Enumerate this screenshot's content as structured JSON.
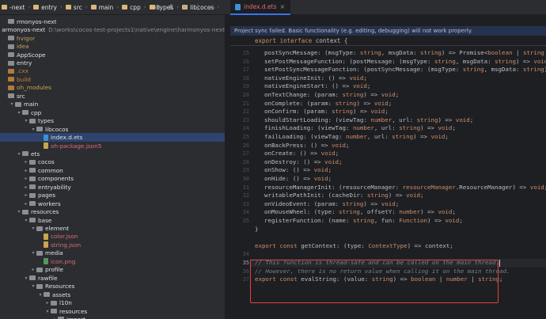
{
  "breadcrumb": [
    {
      "label": "-next",
      "kind": "folder"
    },
    {
      "label": "entry",
      "kind": "folder"
    },
    {
      "label": "src",
      "kind": "folder"
    },
    {
      "label": "main",
      "kind": "folder"
    },
    {
      "label": "cpp",
      "kind": "folder"
    },
    {
      "label": "types",
      "kind": "folder"
    },
    {
      "label": "libcocos",
      "kind": "folder"
    },
    {
      "label": "index.d.ets",
      "kind": "file"
    }
  ],
  "toolbar_icons": [
    "target-icon",
    "collapse-icon",
    "close-icon",
    "settings-icon",
    "minimize-icon"
  ],
  "editor_tab": {
    "label": "index.d.ets",
    "close": "×"
  },
  "notice": "Project sync failed. Basic functionality (e.g. editing, debugging) will not work properly.",
  "tree": [
    {
      "label": "rmonyos-next",
      "indent": 0,
      "icon": "folder",
      "style": "norm"
    },
    {
      "label": "armonyos-next",
      "path": "D:\\works\\cocos-test-projects1\\native\\engine\\harmonyos-next",
      "indent": 0,
      "icon": "none",
      "style": "norm"
    },
    {
      "label": "hvigor",
      "indent": 0,
      "icon": "folder",
      "style": "dim"
    },
    {
      "label": "idea",
      "indent": 0,
      "icon": "folder",
      "style": "dim"
    },
    {
      "label": "AppScope",
      "indent": 0,
      "icon": "folder",
      "style": "norm"
    },
    {
      "label": "entry",
      "indent": 0,
      "icon": "folder",
      "style": "norm"
    },
    {
      "label": ".cxx",
      "indent": 0,
      "icon": "folder-o",
      "style": "brown"
    },
    {
      "label": "build",
      "indent": 0,
      "icon": "folder-o",
      "style": "brown"
    },
    {
      "label": "oh_modules",
      "indent": 0,
      "icon": "folder-o",
      "style": "yel"
    },
    {
      "label": "src",
      "indent": 0,
      "icon": "folder",
      "style": "norm"
    },
    {
      "label": "main",
      "indent": 1,
      "arrow": "down",
      "icon": "folder",
      "style": "norm"
    },
    {
      "label": "cpp",
      "indent": 2,
      "arrow": "down",
      "icon": "folder",
      "style": "norm"
    },
    {
      "label": "types",
      "indent": 3,
      "arrow": "down",
      "icon": "folder",
      "style": "norm"
    },
    {
      "label": "libcocos",
      "indent": 4,
      "arrow": "down",
      "icon": "folder",
      "style": "norm"
    },
    {
      "label": "index.d.ets",
      "indent": 5,
      "icon": "file",
      "style": "norm",
      "selected": true
    },
    {
      "label": "oh-package.json5",
      "indent": 5,
      "icon": "file-j",
      "style": "red"
    },
    {
      "label": "ets",
      "indent": 2,
      "arrow": "down",
      "icon": "folder",
      "style": "norm"
    },
    {
      "label": "cocos",
      "indent": 3,
      "arrow": "right",
      "icon": "folder",
      "style": "norm"
    },
    {
      "label": "common",
      "indent": 3,
      "arrow": "right",
      "icon": "folder",
      "style": "norm"
    },
    {
      "label": "components",
      "indent": 3,
      "arrow": "right",
      "icon": "folder",
      "style": "norm"
    },
    {
      "label": "entryability",
      "indent": 3,
      "arrow": "right",
      "icon": "folder",
      "style": "norm"
    },
    {
      "label": "pages",
      "indent": 3,
      "arrow": "right",
      "icon": "folder",
      "style": "norm"
    },
    {
      "label": "workers",
      "indent": 3,
      "arrow": "right",
      "icon": "folder",
      "style": "norm"
    },
    {
      "label": "resources",
      "indent": 2,
      "arrow": "down",
      "icon": "folder",
      "style": "norm"
    },
    {
      "label": "base",
      "indent": 3,
      "arrow": "down",
      "icon": "folder",
      "style": "norm"
    },
    {
      "label": "element",
      "indent": 4,
      "arrow": "down",
      "icon": "folder",
      "style": "norm"
    },
    {
      "label": "color.json",
      "indent": 5,
      "icon": "file-j",
      "style": "red"
    },
    {
      "label": "string.json",
      "indent": 5,
      "icon": "file-j",
      "style": "red"
    },
    {
      "label": "media",
      "indent": 4,
      "arrow": "down",
      "icon": "folder",
      "style": "norm"
    },
    {
      "label": "icon.png",
      "indent": 5,
      "icon": "file-p",
      "style": "red"
    },
    {
      "label": "profile",
      "indent": 4,
      "arrow": "right",
      "icon": "folder",
      "style": "norm"
    },
    {
      "label": "rawfile",
      "indent": 3,
      "arrow": "down",
      "icon": "folder",
      "style": "norm"
    },
    {
      "label": "Resources",
      "indent": 4,
      "arrow": "down",
      "icon": "folder",
      "style": "norm"
    },
    {
      "label": "assets",
      "indent": 5,
      "arrow": "down",
      "icon": "folder",
      "style": "norm"
    },
    {
      "label": "l10n",
      "indent": 6,
      "arrow": "right",
      "icon": "folder",
      "style": "norm"
    },
    {
      "label": "resources",
      "indent": 6,
      "arrow": "down",
      "icon": "folder",
      "style": "norm"
    },
    {
      "label": "import",
      "indent": 7,
      "arrow": "right",
      "icon": "folder",
      "style": "norm"
    }
  ],
  "sticky_header": [
    {
      "t": "export ",
      "c": "kw"
    },
    {
      "t": "interface ",
      "c": "kw"
    },
    {
      "t": "context {",
      "c": "fn"
    }
  ],
  "code": [
    {
      "n": "15",
      "parts": [
        {
          "t": "postSyncMessage: (msgType: "
        },
        {
          "t": "string",
          "c": "kw"
        },
        {
          "t": ", msgData: "
        },
        {
          "t": "string",
          "c": "kw"
        },
        {
          "t": ") => Promise<"
        },
        {
          "t": "boolean",
          "c": "kw"
        },
        {
          "t": " | "
        },
        {
          "t": "string",
          "c": "kw"
        },
        {
          "t": " | "
        },
        {
          "t": "number",
          "c": "kw"
        },
        {
          "t": ">;"
        }
      ]
    },
    {
      "n": "16",
      "parts": [
        {
          "t": "setPostMessageFunction: (postMessage: (msgType: "
        },
        {
          "t": "string",
          "c": "kw"
        },
        {
          "t": ", msgData: "
        },
        {
          "t": "string",
          "c": "kw"
        },
        {
          "t": ") => "
        },
        {
          "t": "void",
          "c": "kw"
        },
        {
          "t": ") => "
        },
        {
          "t": "void",
          "c": "kw"
        },
        {
          "t": ";"
        }
      ]
    },
    {
      "n": "17",
      "parts": [
        {
          "t": "setPostSyncMessageFunction: (postSyncMessage: (msgType: "
        },
        {
          "t": "string",
          "c": "kw"
        },
        {
          "t": ", msgData: "
        },
        {
          "t": "string",
          "c": "kw"
        },
        {
          "t": ") => "
        },
        {
          "t": "void",
          "c": "kw"
        },
        {
          "t": ") => "
        },
        {
          "t": "void",
          "c": "kw"
        },
        {
          "t": ";"
        }
      ]
    },
    {
      "n": "18",
      "parts": [
        {
          "t": "nativeEngineInit: () => "
        },
        {
          "t": "void",
          "c": "kw"
        },
        {
          "t": ";"
        }
      ]
    },
    {
      "n": "19",
      "parts": [
        {
          "t": "nativeEngineStart: () => "
        },
        {
          "t": "void",
          "c": "kw"
        },
        {
          "t": ";"
        }
      ]
    },
    {
      "n": "20",
      "parts": [
        {
          "t": "onTextChange: (param: "
        },
        {
          "t": "string",
          "c": "kw"
        },
        {
          "t": ") => "
        },
        {
          "t": "void",
          "c": "kw"
        },
        {
          "t": ";"
        }
      ]
    },
    {
      "n": "21",
      "parts": [
        {
          "t": "onComplete: (param: "
        },
        {
          "t": "string",
          "c": "kw"
        },
        {
          "t": ") => "
        },
        {
          "t": "void",
          "c": "kw"
        },
        {
          "t": ";"
        }
      ]
    },
    {
      "n": "22",
      "parts": [
        {
          "t": "onConfirm: (param: "
        },
        {
          "t": "string",
          "c": "kw"
        },
        {
          "t": ") => "
        },
        {
          "t": "void",
          "c": "kw"
        },
        {
          "t": ";"
        }
      ]
    },
    {
      "n": "23",
      "parts": [
        {
          "t": "shouldStartLoading: (viewTag: "
        },
        {
          "t": "number",
          "c": "kw"
        },
        {
          "t": ", url: "
        },
        {
          "t": "string",
          "c": "kw"
        },
        {
          "t": ") => "
        },
        {
          "t": "void",
          "c": "kw"
        },
        {
          "t": ";"
        }
      ]
    },
    {
      "n": "24",
      "parts": [
        {
          "t": "finishLoading: (viewTag: "
        },
        {
          "t": "number",
          "c": "kw"
        },
        {
          "t": ", url: "
        },
        {
          "t": "string",
          "c": "kw"
        },
        {
          "t": ") => "
        },
        {
          "t": "void",
          "c": "kw"
        },
        {
          "t": ";"
        }
      ]
    },
    {
      "n": "25",
      "parts": [
        {
          "t": "failLoading: (viewTag: "
        },
        {
          "t": "number",
          "c": "kw"
        },
        {
          "t": ", url: "
        },
        {
          "t": "string",
          "c": "kw"
        },
        {
          "t": ") => "
        },
        {
          "t": "void",
          "c": "kw"
        },
        {
          "t": ";"
        }
      ]
    },
    {
      "n": "26",
      "parts": [
        {
          "t": "onBackPress: () => "
        },
        {
          "t": "void",
          "c": "kw"
        },
        {
          "t": ";"
        }
      ]
    },
    {
      "n": "27",
      "parts": [
        {
          "t": "onCreate: () => "
        },
        {
          "t": "void",
          "c": "kw"
        },
        {
          "t": ";"
        }
      ]
    },
    {
      "n": "28",
      "parts": [
        {
          "t": "onDestroy: () => "
        },
        {
          "t": "void",
          "c": "kw"
        },
        {
          "t": ";"
        }
      ]
    },
    {
      "n": "29",
      "parts": [
        {
          "t": "onShow: () => "
        },
        {
          "t": "void",
          "c": "kw"
        },
        {
          "t": ";"
        }
      ]
    },
    {
      "n": "30",
      "parts": [
        {
          "t": "onHide: () => "
        },
        {
          "t": "void",
          "c": "kw"
        },
        {
          "t": ";"
        }
      ]
    },
    {
      "n": "31",
      "parts": [
        {
          "t": "resourceManagerInit: (resourceManager: "
        },
        {
          "t": "resourceManager",
          "c": "kw"
        },
        {
          "t": "."
        },
        {
          "t": "ResourceManager",
          "c": "fn"
        },
        {
          "t": ") => "
        },
        {
          "t": "void",
          "c": "kw"
        },
        {
          "t": ";"
        }
      ]
    },
    {
      "n": "32",
      "parts": [
        {
          "t": "writablePathInit: (cacheDir: "
        },
        {
          "t": "string",
          "c": "kw"
        },
        {
          "t": ") => "
        },
        {
          "t": "void",
          "c": "kw"
        },
        {
          "t": ";"
        }
      ]
    },
    {
      "n": "33",
      "parts": [
        {
          "t": "onVideoEvent: (param: "
        },
        {
          "t": "string",
          "c": "kw"
        },
        {
          "t": ") => "
        },
        {
          "t": "void",
          "c": "kw"
        },
        {
          "t": ";"
        }
      ]
    },
    {
      "n": "34",
      "parts": [
        {
          "t": "onMouseWheel: (type: "
        },
        {
          "t": "string",
          "c": "kw"
        },
        {
          "t": ", offsetY: "
        },
        {
          "t": "number",
          "c": "kw"
        },
        {
          "t": ") => "
        },
        {
          "t": "void",
          "c": "kw"
        },
        {
          "t": ";"
        }
      ]
    },
    {
      "n": "35",
      "parts": [
        {
          "t": "registerFunction: (name: "
        },
        {
          "t": "string",
          "c": "kw"
        },
        {
          "t": ", fun: "
        },
        {
          "t": "Function",
          "c": "kw"
        },
        {
          "t": ") => "
        },
        {
          "t": "void",
          "c": "kw"
        },
        {
          "t": ";"
        }
      ]
    },
    {
      "n": "",
      "parts": [
        {
          "t": "}",
          "c": "fn"
        }
      ]
    },
    {
      "n": "",
      "parts": [
        {
          "t": ""
        }
      ]
    },
    {
      "n": "",
      "parts": [
        {
          "t": "export ",
          "c": "kw"
        },
        {
          "t": "const ",
          "c": "kw"
        },
        {
          "t": "getContext: (type: "
        },
        {
          "t": "ContextType",
          "c": "kw"
        },
        {
          "t": ") => context;"
        }
      ]
    },
    {
      "n": "34",
      "parts": [
        {
          "t": ""
        }
      ]
    },
    {
      "n": "35",
      "cur": true,
      "parts": [
        {
          "t": "// This function is thread-safe and can be called on the main thread.",
          "c": "cmt"
        }
      ]
    },
    {
      "n": "36",
      "parts": [
        {
          "t": "// However, there is no return value when calling it on the main thread.",
          "c": "cmt"
        }
      ]
    },
    {
      "n": "37",
      "parts": [
        {
          "t": "export ",
          "c": "kw"
        },
        {
          "t": "const ",
          "c": "kw"
        },
        {
          "t": "evalString: (value: "
        },
        {
          "t": "string",
          "c": "kw"
        },
        {
          "t": ") => "
        },
        {
          "t": "boolean",
          "c": "kw"
        },
        {
          "t": " | "
        },
        {
          "t": "number",
          "c": "kw"
        },
        {
          "t": " | "
        },
        {
          "t": "string",
          "c": "kw"
        },
        {
          "t": ";"
        }
      ]
    }
  ]
}
